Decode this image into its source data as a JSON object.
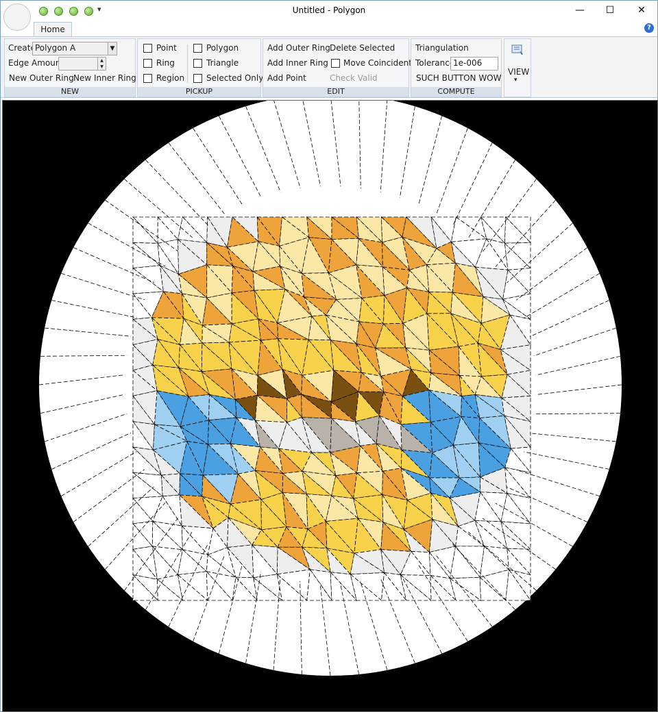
{
  "window": {
    "title": "Untitled - Polygon",
    "controls": {
      "minimize": "—",
      "maximize": "☐",
      "close": "✕"
    }
  },
  "qat": {
    "more_glyph": "▾"
  },
  "tabs": [
    {
      "label": "Home",
      "active": true
    }
  ],
  "help": {
    "glyph": "?"
  },
  "ribbon": {
    "new": {
      "label": "NEW",
      "create_label": "Create",
      "create_value": "Polygon A",
      "edge_amount_label": "Edge Amount",
      "edge_amount_value": "",
      "new_outer_ring": "New Outer Ring",
      "new_inner_ring": "New Inner Ring"
    },
    "pickup": {
      "label": "PICKUP",
      "options": [
        {
          "label": "Point",
          "checked": false
        },
        {
          "label": "Ring",
          "checked": false
        },
        {
          "label": "Region",
          "checked": false
        },
        {
          "label": "Polygon",
          "checked": false
        },
        {
          "label": "Triangle",
          "checked": false
        },
        {
          "label": "Selected Only",
          "checked": false
        }
      ]
    },
    "edit": {
      "label": "EDIT",
      "add_outer_ring": "Add Outer Ring",
      "add_inner_ring": "Add Inner Ring",
      "add_point": "Add Point",
      "delete_selected": "Delete Selected",
      "move_coincident": "Move Coincident",
      "move_coincident_checked": false,
      "check_valid": "Check Valid"
    },
    "compute": {
      "label": "COMPUTE",
      "triangulation": "Triangulation",
      "tolerance_label": "Tolerance",
      "tolerance_value": "1e-006",
      "such_button": "SUCH BUTTON WOW"
    },
    "view": {
      "label": "VIEW",
      "dropdown_glyph": "▾",
      "icon": "view-icon"
    }
  },
  "canvas": {
    "background": "#000000",
    "disc_color": "#ffffff",
    "palette": {
      "light_yellow": "#fbe7a6",
      "yellow": "#f7d24a",
      "orange": "#eea43a",
      "dark_brown": "#7a5010",
      "blue": "#4aa0e0",
      "light_blue": "#9fd0f2",
      "grey": "#b9b2a8",
      "pale": "#eeeeee"
    }
  }
}
